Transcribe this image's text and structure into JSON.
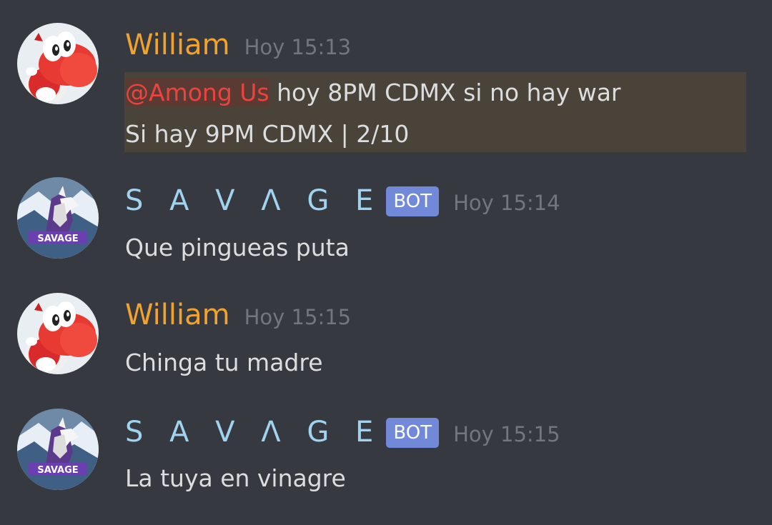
{
  "messages": [
    {
      "author": "William",
      "time": "Hoy 15:13",
      "mention": "@Among Us",
      "line1": " hoy 8PM CDMX si no hay war",
      "line2": "Si hay 9PM CDMX | 2/10"
    },
    {
      "author": "S A V Λ G E",
      "bot_tag": "BOT",
      "time": "Hoy 15:14",
      "text": "Que pingueas puta"
    },
    {
      "author": "William",
      "time": "Hoy 15:15",
      "text": "Chinga tu madre"
    },
    {
      "author": "S A V Λ G E",
      "bot_tag": "BOT",
      "time": "Hoy 15:15",
      "text": "La tuya en vinagre"
    }
  ],
  "avatars": {
    "william": "red-yoshi-avatar",
    "savage": "wolf-logo-avatar",
    "savage_logo_text": "SAVAGE"
  },
  "colors": {
    "background": "#36393f",
    "william_name": "#f1a32e",
    "savage_name": "#9fd3ef",
    "bot_tag": "#7289da",
    "mention_text": "#e84540",
    "mention_highlight": "#4a433a",
    "timestamp": "#72767d",
    "message_text": "#dcddde"
  }
}
